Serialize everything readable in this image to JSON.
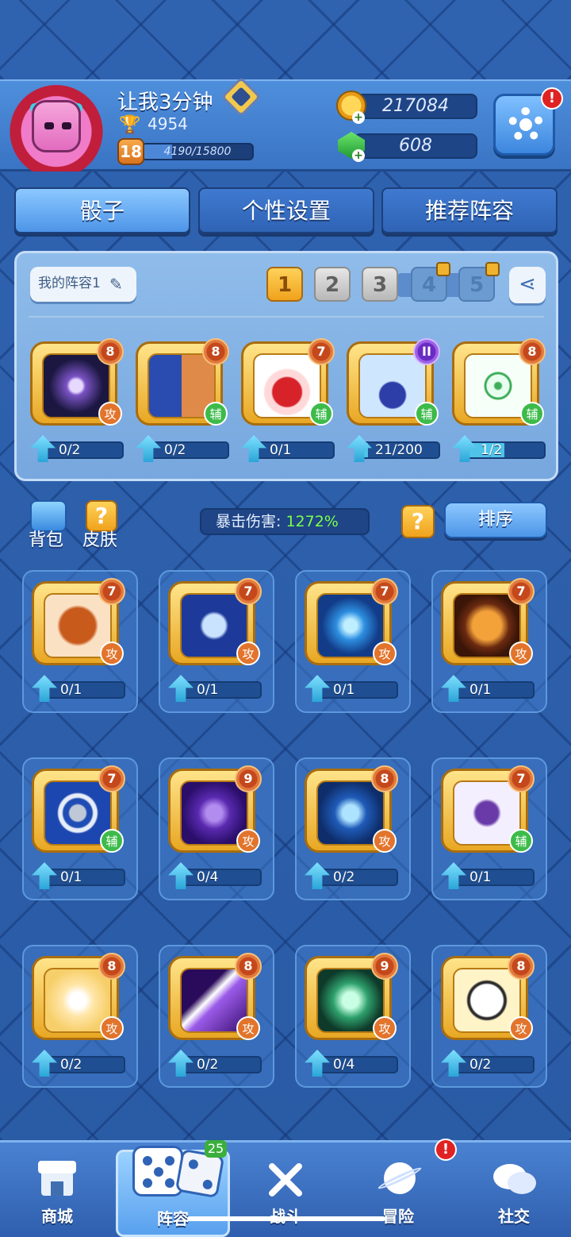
{
  "player": {
    "name": "让我3分钟",
    "trophies": "4954",
    "level": "18",
    "xp_text": "4190/15800",
    "xp_fraction": 0.265
  },
  "currency": {
    "gold": "217084",
    "gems": "608"
  },
  "alerts": {
    "settings": "!",
    "adventure": "!"
  },
  "tabs": [
    "骰子",
    "个性设置",
    "推荐阵容"
  ],
  "deck": {
    "name": "我的阵容1",
    "slots": [
      "1",
      "2",
      "3",
      "4",
      "5"
    ],
    "cards": [
      {
        "icon": "galaxy-dice-icon",
        "level": "8",
        "role": "攻",
        "progress": "0/2",
        "fill": 0
      },
      {
        "icon": "gemini-dice-icon",
        "level": "8",
        "role": "辅",
        "progress": "0/2",
        "fill": 0
      },
      {
        "icon": "red-hat-dice-icon",
        "level": "7",
        "role": "辅",
        "progress": "0/1",
        "fill": 0
      },
      {
        "icon": "magic-hat-dice-icon",
        "level": "II",
        "role": "辅",
        "progress": "21/200",
        "fill": 0.105
      },
      {
        "icon": "hexagram-dice-icon",
        "level": "8",
        "role": "辅",
        "progress": "1/2",
        "fill": 0.5
      }
    ]
  },
  "middle": {
    "bag_label": "背包",
    "skin_label": "皮肤",
    "skin_glyph": "?",
    "crit_label": "暴击伤害:",
    "crit_value": "1272%",
    "help_glyph": "?",
    "sort_label": "排序"
  },
  "collection": [
    {
      "icon": "sagittarius-dice-icon",
      "level": "7",
      "role": "攻",
      "progress": "0/1"
    },
    {
      "icon": "cancer-dice-icon",
      "level": "7",
      "role": "攻",
      "progress": "0/1"
    },
    {
      "icon": "whirlwind-dice-icon",
      "level": "7",
      "role": "攻",
      "progress": "0/1"
    },
    {
      "icon": "tiger-dice-icon",
      "level": "7",
      "role": "攻",
      "progress": "0/1"
    },
    {
      "icon": "shield-dice-icon",
      "level": "7",
      "role": "辅",
      "progress": "0/1"
    },
    {
      "icon": "archer-dice-icon",
      "level": "9",
      "role": "攻",
      "progress": "0/4"
    },
    {
      "icon": "scorpio-dice-icon",
      "level": "8",
      "role": "攻",
      "progress": "0/2"
    },
    {
      "icon": "witch-hat-dice-icon",
      "level": "7",
      "role": "辅",
      "progress": "0/1"
    },
    {
      "icon": "holy-cross-dice-icon",
      "level": "8",
      "role": "攻",
      "progress": "0/2"
    },
    {
      "icon": "purple-strike-dice-icon",
      "level": "8",
      "role": "攻",
      "progress": "0/2"
    },
    {
      "icon": "ghost-dice-icon",
      "level": "9",
      "role": "攻",
      "progress": "0/4"
    },
    {
      "icon": "panda-dice-icon",
      "level": "8",
      "role": "攻",
      "progress": "0/2"
    }
  ],
  "nav": [
    {
      "label": "商城",
      "icon": "shop-icon"
    },
    {
      "label": "阵容",
      "icon": "dice-icon",
      "badge": "25"
    },
    {
      "label": "战斗",
      "icon": "crossed-swords-icon"
    },
    {
      "label": "冒险",
      "icon": "planet-icon"
    },
    {
      "label": "社交",
      "icon": "chat-icon"
    }
  ],
  "colors": {
    "background": "#2c5aa0",
    "gold": "#f0a21c",
    "attack_role": "#e2742c",
    "support_role": "#3dbb4a",
    "crit_value": "#7bff4a",
    "alert": "#e02222"
  }
}
